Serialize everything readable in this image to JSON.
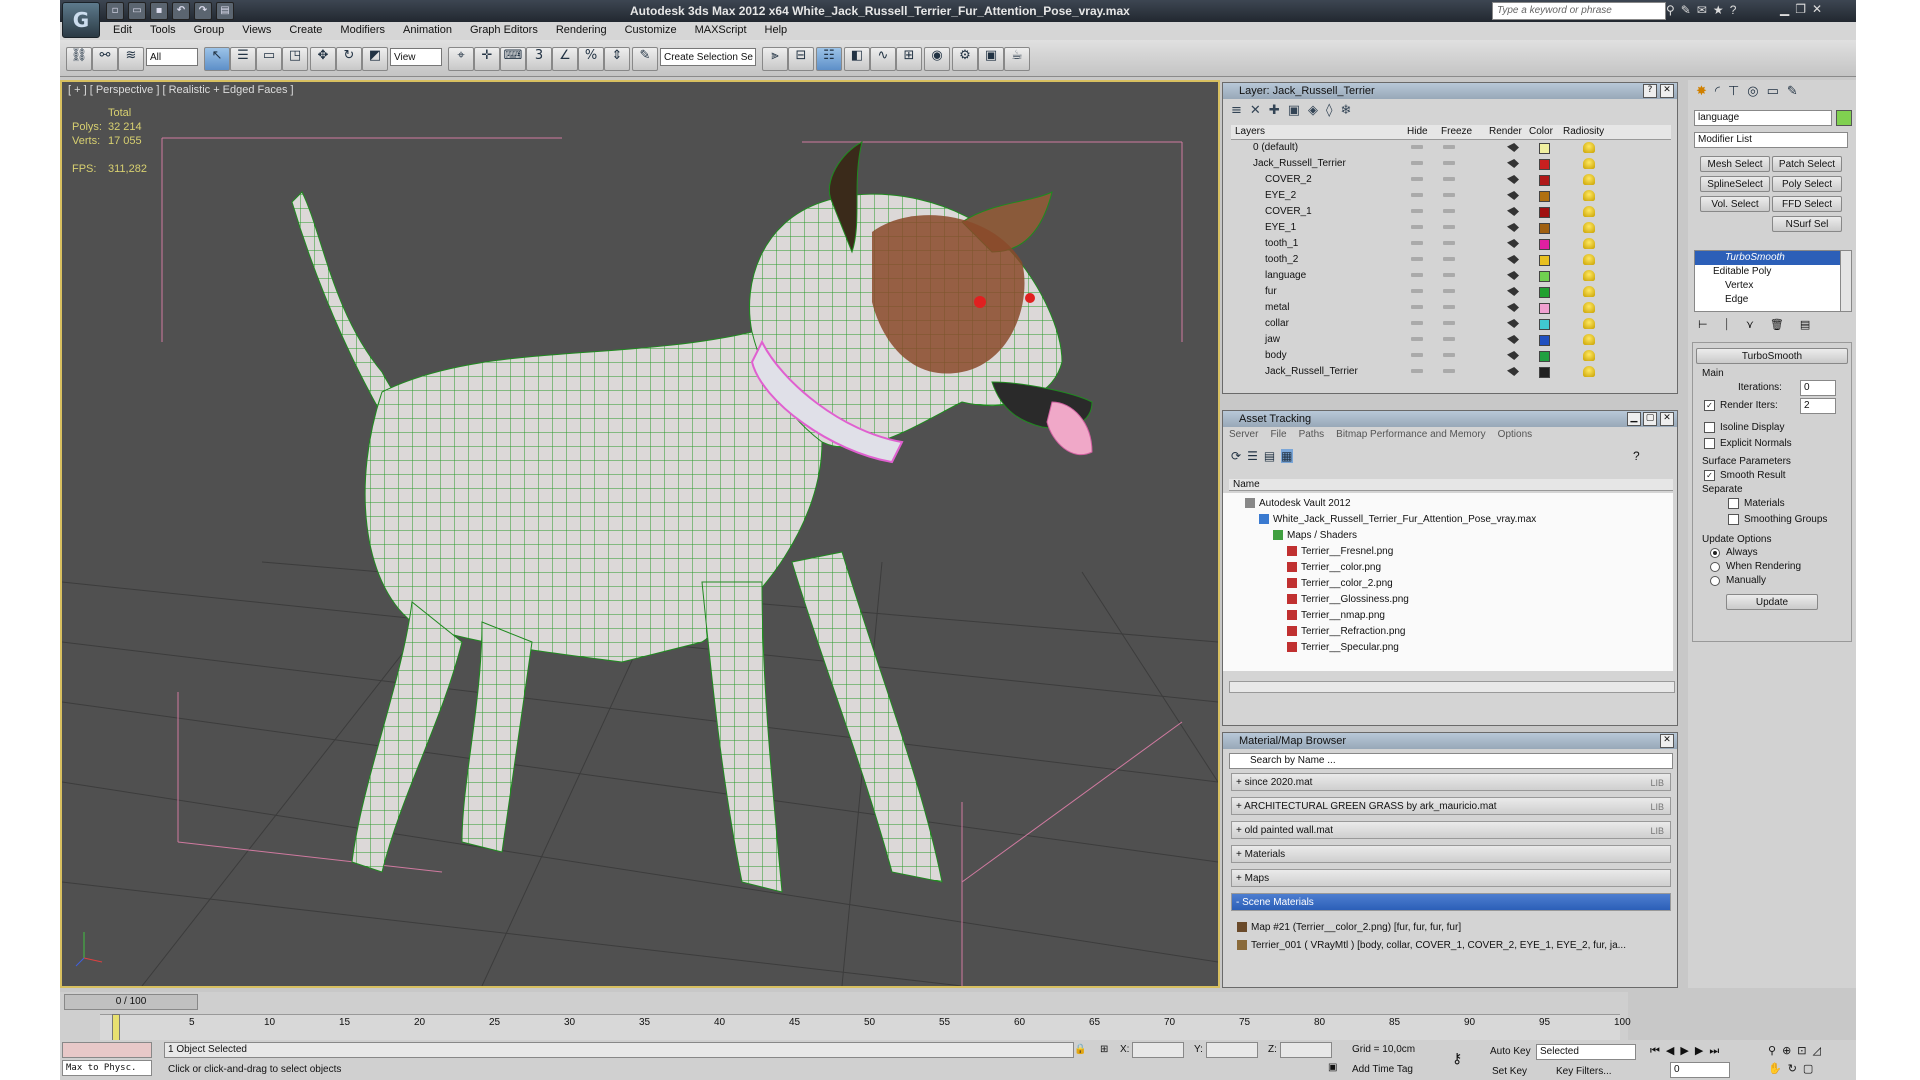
{
  "title_bar": {
    "app_title": "Autodesk 3ds Max  2012 x64      White_Jack_Russell_Terrier_Fur_Attention_Pose_vray.max",
    "search_placeholder": "Type a keyword or phrase"
  },
  "menu": [
    "Edit",
    "Tools",
    "Group",
    "Views",
    "Create",
    "Modifiers",
    "Animation",
    "Graph Editors",
    "Rendering",
    "Customize",
    "MAXScript",
    "Help"
  ],
  "toolbar": {
    "selection_filter": "All",
    "ref_coord": "View",
    "named_selection": "Create Selection Se",
    "snap_label": "3"
  },
  "viewport": {
    "label": "[ + ] [ Perspective ] [ Realistic + Edged Faces ]",
    "stats": {
      "total_label": "Total",
      "polys_label": "Polys:",
      "polys_value": "32 214",
      "verts_label": "Verts:",
      "verts_value": "17 055",
      "fps_label": "FPS:",
      "fps_value": "311,282"
    }
  },
  "layer_panel": {
    "title": "Layer: Jack_Russell_Terrier",
    "columns": [
      "Layers",
      "Hide",
      "Freeze",
      "Render",
      "Color",
      "Radiosity"
    ],
    "rows": [
      {
        "name": "0 (default)",
        "indent": 0,
        "color": "#f0f0a0"
      },
      {
        "name": "Jack_Russell_Terrier",
        "indent": 0,
        "color": "#c82020"
      },
      {
        "name": "COVER_2",
        "indent": 1,
        "color": "#b01818"
      },
      {
        "name": "EYE_2",
        "indent": 1,
        "color": "#b07010"
      },
      {
        "name": "COVER_1",
        "indent": 1,
        "color": "#a01010"
      },
      {
        "name": "EYE_1",
        "indent": 1,
        "color": "#a06010"
      },
      {
        "name": "tooth_1",
        "indent": 1,
        "color": "#e020a0"
      },
      {
        "name": "tooth_2",
        "indent": 1,
        "color": "#e8c020"
      },
      {
        "name": "language",
        "indent": 1,
        "color": "#70d050"
      },
      {
        "name": "fur",
        "indent": 1,
        "color": "#20a030"
      },
      {
        "name": "metal",
        "indent": 1,
        "color": "#f0a0d0"
      },
      {
        "name": "collar",
        "indent": 1,
        "color": "#40c8d0"
      },
      {
        "name": "jaw",
        "indent": 1,
        "color": "#2050c0"
      },
      {
        "name": "body",
        "indent": 1,
        "color": "#20a040"
      },
      {
        "name": "Jack_Russell_Terrier",
        "indent": 1,
        "color": "#202020"
      }
    ]
  },
  "asset_tracking": {
    "title": "Asset Tracking",
    "menu": [
      "Server",
      "File",
      "Paths",
      "Bitmap Performance and Memory",
      "Options"
    ],
    "column": "Name",
    "rows": [
      {
        "name": "Autodesk Vault 2012",
        "indent": 1
      },
      {
        "name": "White_Jack_Russell_Terrier_Fur_Attention_Pose_vray.max",
        "indent": 2
      },
      {
        "name": "Maps / Shaders",
        "indent": 3
      },
      {
        "name": "Terrier__Fresnel.png",
        "indent": 4
      },
      {
        "name": "Terrier__color.png",
        "indent": 4
      },
      {
        "name": "Terrier__color_2.png",
        "indent": 4
      },
      {
        "name": "Terrier__Glossiness.png",
        "indent": 4
      },
      {
        "name": "Terrier__nmap.png",
        "indent": 4
      },
      {
        "name": "Terrier__Refraction.png",
        "indent": 4
      },
      {
        "name": "Terrier__Specular.png",
        "indent": 4
      }
    ]
  },
  "material_browser": {
    "title": "Material/Map Browser",
    "search_placeholder": "Search by Name ...",
    "groups": [
      {
        "name": "+ since 2020.mat",
        "lib": "LIB"
      },
      {
        "name": "+ ARCHITECTURAL GREEN GRASS by ark_mauricio.mat",
        "lib": "LIB"
      },
      {
        "name": "+ old painted wall.mat",
        "lib": "LIB"
      },
      {
        "name": "+ Materials",
        "lib": ""
      },
      {
        "name": "+ Maps",
        "lib": ""
      },
      {
        "name": "- Scene Materials",
        "lib": ""
      }
    ],
    "scene_items": [
      "Map #21 (Terrier__color_2.png)  [fur, fur, fur, fur]",
      "Terrier_001  ( VRayMtl )  [body, collar, COVER_1, COVER_2, EYE_1, EYE_2, fur, ja..."
    ]
  },
  "command_panel": {
    "object_name": "language",
    "modifier_list": "Modifier List",
    "buttons": [
      "Mesh Select",
      "Patch Select",
      "SplineSelect",
      "Poly Select",
      "Vol. Select",
      "FFD Select",
      "NSurf Sel"
    ],
    "stack": [
      "TurboSmooth",
      "Editable Poly",
      "Vertex",
      "Edge"
    ],
    "rollout_title": "TurboSmooth",
    "main_label": "Main",
    "iterations_label": "Iterations:",
    "iterations_value": "0",
    "render_iters_label": "Render Iters:",
    "render_iters_value": "2",
    "isoline_label": "Isoline Display",
    "explicit_normals_label": "Explicit Normals",
    "surface_params_label": "Surface Parameters",
    "smooth_result_label": "Smooth Result",
    "separate_label": "Separate",
    "materials_label": "Materials",
    "smoothing_groups_label": "Smoothing Groups",
    "update_options_label": "Update Options",
    "always_label": "Always",
    "when_rendering_label": "When Rendering",
    "manually_label": "Manually",
    "update_button": "Update"
  },
  "timeline": {
    "frame_display": "0 / 100",
    "ticks": [
      "0",
      "5",
      "10",
      "15",
      "20",
      "25",
      "30",
      "35",
      "40",
      "45",
      "50",
      "55",
      "60",
      "65",
      "70",
      "75",
      "80",
      "85",
      "90",
      "95",
      "100"
    ]
  },
  "status_bar": {
    "maxscript_label": "Max to Physc.",
    "selection_status": "1 Object Selected",
    "prompt": "Click or click-and-drag to select objects",
    "x_label": "X:",
    "y_label": "Y:",
    "z_label": "Z:",
    "grid": "Grid = 10,0cm",
    "add_time_tag": "Add Time Tag",
    "auto_key": "Auto Key",
    "selected_value": "Selected",
    "set_key": "Set Key",
    "key_filters": "Key Filters...",
    "frame_value": "0"
  }
}
